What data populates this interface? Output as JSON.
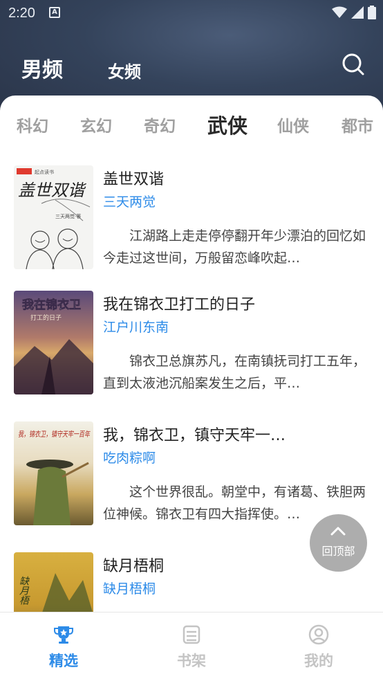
{
  "status_bar": {
    "time": "2:20",
    "app_indicator": "A"
  },
  "header": {
    "tabs": [
      {
        "label": "男频",
        "active": true
      },
      {
        "label": "女频",
        "active": false
      }
    ],
    "search_icon": "search-icon"
  },
  "genres": [
    {
      "label": "科幻",
      "active": false
    },
    {
      "label": "玄幻",
      "active": false
    },
    {
      "label": "奇幻",
      "active": false
    },
    {
      "label": "武侠",
      "active": true
    },
    {
      "label": "仙侠",
      "active": false
    },
    {
      "label": "都市",
      "active": false
    }
  ],
  "books": [
    {
      "title": "盖世双谐",
      "author": "三天两觉",
      "description": "江湖路上走走停停翻开年少漂泊的回忆如今走过这世间，万般留恋峰吹起…",
      "cover_text": "盖世双谐",
      "cover_badge": "起点读书",
      "cover_sub": "三天两觉·著"
    },
    {
      "title": "我在锦衣卫打工的日子",
      "author": "江户川东南",
      "description": "锦衣卫总旗苏凡，在南镇抚司打工五年，直到太液池沉船案发生之后，平…",
      "cover_text": "我在锦衣卫",
      "cover_sub": "打工的日子"
    },
    {
      "title": "我，锦衣卫，镇守天牢一…",
      "author": "吃肉粽啊",
      "description": "这个世界很乱。朝堂中，有诸葛、铁胆两位神候。锦衣卫有四大指挥使。…",
      "cover_text": "我，锦衣卫，镇守天牢一百年"
    },
    {
      "title": "缺月梧桐",
      "author": "缺月梧桐",
      "description": "",
      "cover_text": "缺月梧"
    }
  ],
  "back_to_top": {
    "label": "回顶部"
  },
  "bottom_nav": [
    {
      "label": "精选",
      "icon": "trophy-icon",
      "active": true
    },
    {
      "label": "书架",
      "icon": "bookshelf-icon",
      "active": false
    },
    {
      "label": "我的",
      "icon": "user-icon",
      "active": false
    }
  ],
  "colors": {
    "accent": "#2d8be8",
    "header_bg": "#34435b",
    "inactive": "#c4c4c4"
  }
}
